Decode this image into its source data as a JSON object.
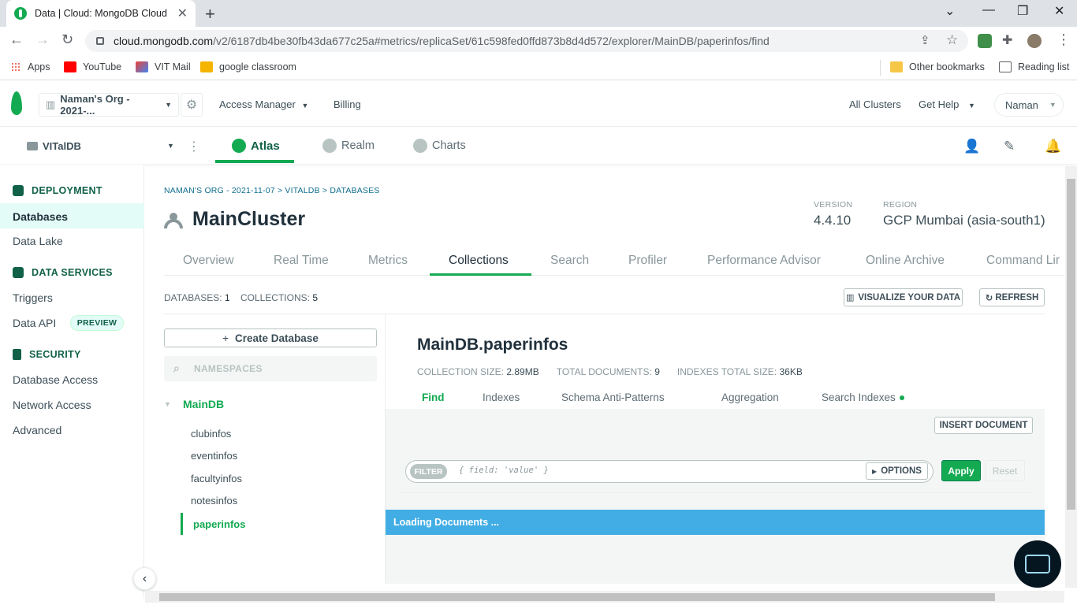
{
  "browser": {
    "tab_title": "Data | Cloud: MongoDB Cloud",
    "url_host": "cloud.mongodb.com",
    "url_path": "/v2/6187db4be30fb43da677c25a#metrics/replicaSet/61c598fed0ffd873b8d4d572/explorer/MainDB/paperinfos/find",
    "bookmarks": [
      "Apps",
      "YouTube",
      "VIT Mail",
      "google classroom"
    ],
    "bookmarks_right": [
      "Other bookmarks",
      "Reading list"
    ]
  },
  "topnav": {
    "org": "Naman's Org - 2021-...",
    "access_manager": "Access Manager",
    "billing": "Billing",
    "all_clusters": "All Clusters",
    "get_help": "Get Help",
    "user": "Naman"
  },
  "project": {
    "name": "VITalDB",
    "tabs": [
      "Atlas",
      "Realm",
      "Charts"
    ]
  },
  "sidebar": {
    "deployment": "DEPLOYMENT",
    "databases": "Databases",
    "data_lake": "Data Lake",
    "data_services": "DATA SERVICES",
    "triggers": "Triggers",
    "data_api": "Data API",
    "preview": "PREVIEW",
    "security": "SECURITY",
    "database_access": "Database Access",
    "network_access": "Network Access",
    "advanced": "Advanced"
  },
  "cluster": {
    "breadcrumb": "NAMAN'S ORG - 2021-11-07 > VITALDB > DATABASES",
    "name": "MainCluster",
    "version_label": "VERSION",
    "version": "4.4.10",
    "region_label": "REGION",
    "region": "GCP Mumbai (asia-south1)",
    "tabs": [
      "Overview",
      "Real Time",
      "Metrics",
      "Collections",
      "Search",
      "Profiler",
      "Performance Advisor",
      "Online Archive",
      "Command Lir"
    ]
  },
  "collections": {
    "databases_label": "DATABASES:",
    "databases_count": "1",
    "collections_label": "COLLECTIONS:",
    "collections_count": "5",
    "visualize": "VISUALIZE YOUR DATA",
    "refresh": "REFRESH",
    "create_db": "Create Database",
    "namespaces_placeholder": "NAMESPACES",
    "db_name": "MainDB",
    "items": [
      "clubinfos",
      "eventinfos",
      "facultyinfos",
      "notesinfos",
      "paperinfos"
    ]
  },
  "detail": {
    "title": "MainDB.paperinfos",
    "size_label": "COLLECTION SIZE:",
    "size": "2.89MB",
    "docs_label": "TOTAL DOCUMENTS:",
    "docs": "9",
    "idx_label": "INDEXES TOTAL SIZE:",
    "idx": "36KB",
    "subtabs": [
      "Find",
      "Indexes",
      "Schema Anti-Patterns",
      "Aggregation",
      "Search Indexes"
    ],
    "insert": "INSERT DOCUMENT",
    "filter": "FILTER",
    "filter_placeholder": "{ field: 'value' }",
    "options": "OPTIONS",
    "apply": "Apply",
    "reset": "Reset",
    "loading": "Loading Documents ..."
  },
  "colors": {
    "brand_green": "#13aa52",
    "loading_blue": "#42ade4"
  }
}
